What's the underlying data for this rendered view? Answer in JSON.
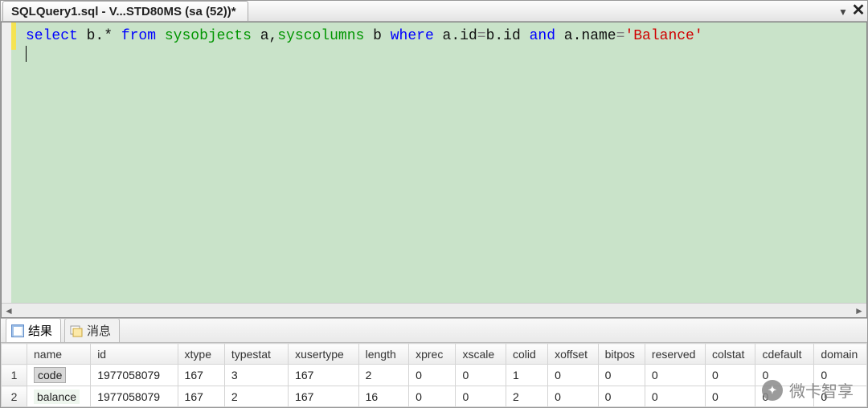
{
  "titlebar": {
    "tab_label": "SQLQuery1.sql - V...STD80MS (sa (52))*"
  },
  "sql": {
    "tok_select": "select",
    "tok_bstar": " b.* ",
    "tok_from": "from",
    "tok_sp1": " ",
    "tok_sysobjects": "sysobjects",
    "tok_a_comma": " a,",
    "tok_syscolumns": "syscolumns",
    "tok_b_sp": " b ",
    "tok_where": "where",
    "tok_cond1a": " a.id",
    "tok_eq1": "=",
    "tok_cond1b": "b.id ",
    "tok_and": "and",
    "tok_cond2a": " a.name",
    "tok_eq2": "=",
    "tok_str": "'Balance'"
  },
  "tabs": {
    "results": "结果",
    "messages": "消息"
  },
  "columns": [
    "name",
    "id",
    "xtype",
    "typestat",
    "xusertype",
    "length",
    "xprec",
    "xscale",
    "colid",
    "xoffset",
    "bitpos",
    "reserved",
    "colstat",
    "cdefault",
    "domain"
  ],
  "rows": [
    {
      "rn": "1",
      "name": "code",
      "id": "1977058079",
      "xtype": "167",
      "typestat": "3",
      "xusertype": "167",
      "length": "2",
      "xprec": "0",
      "xscale": "0",
      "colid": "1",
      "xoffset": "0",
      "bitpos": "0",
      "reserved": "0",
      "colstat": "0",
      "cdefault": "0",
      "domain": "0"
    },
    {
      "rn": "2",
      "name": "balance",
      "id": "1977058079",
      "xtype": "167",
      "typestat": "2",
      "xusertype": "167",
      "length": "16",
      "xprec": "0",
      "xscale": "0",
      "colid": "2",
      "xoffset": "0",
      "bitpos": "0",
      "reserved": "0",
      "colstat": "0",
      "cdefault": "0",
      "domain": "0"
    }
  ],
  "watermark": {
    "text": "微卡智享"
  }
}
